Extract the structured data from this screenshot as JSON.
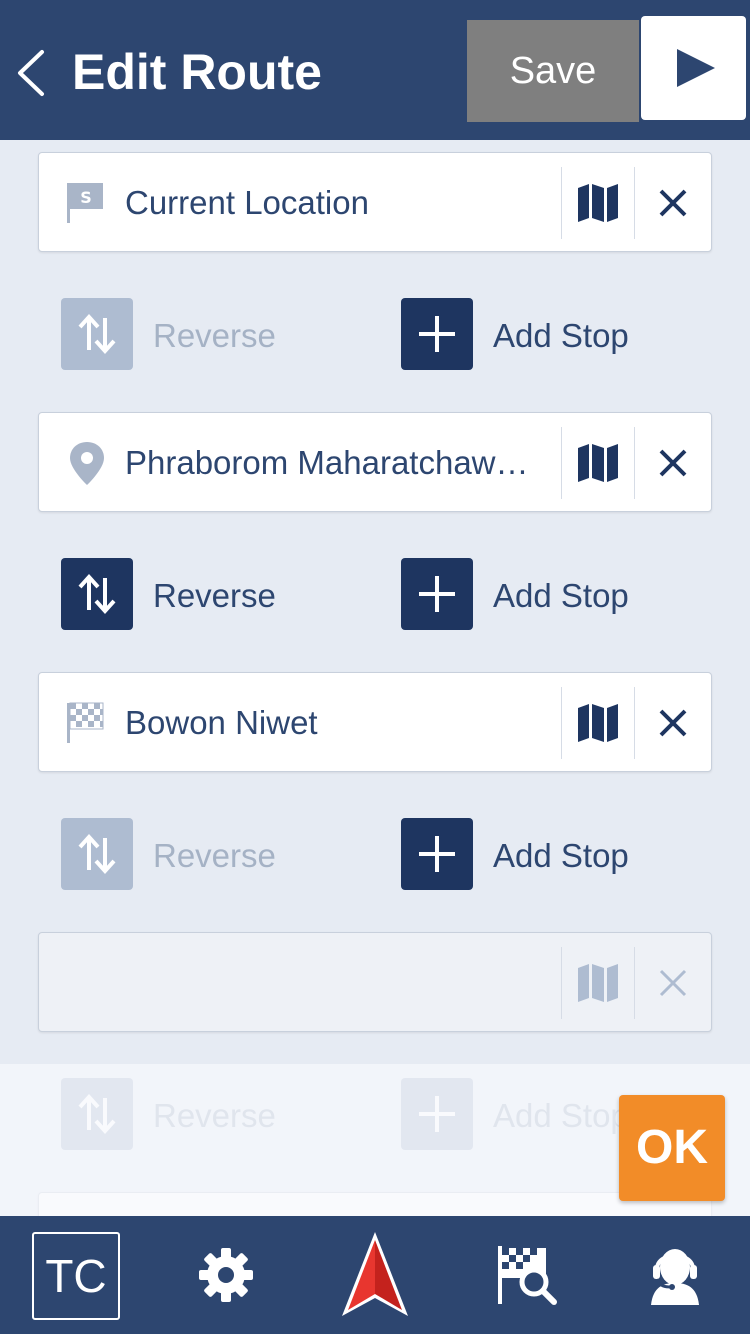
{
  "header": {
    "title": "Edit Route",
    "save_label": "Save"
  },
  "stops": [
    {
      "name": "Current Location",
      "icon": "start-flag-icon",
      "enabled": true
    },
    {
      "name": "Phraborom Maharatchawang",
      "icon": "location-pin-icon",
      "enabled": true
    },
    {
      "name": "Bowon Niwet",
      "icon": "finish-flag-icon",
      "enabled": true
    },
    {
      "name": "",
      "icon": "none",
      "enabled": false
    }
  ],
  "actions": [
    {
      "reverse_label": "Reverse",
      "reverse_enabled": false,
      "add_stop_label": "Add Stop",
      "add_stop_enabled": true
    },
    {
      "reverse_label": "Reverse",
      "reverse_enabled": true,
      "add_stop_label": "Add Stop",
      "add_stop_enabled": true
    },
    {
      "reverse_label": "Reverse",
      "reverse_enabled": false,
      "add_stop_label": "Add Stop",
      "add_stop_enabled": true
    },
    {
      "reverse_label": "Reverse",
      "reverse_enabled": false,
      "add_stop_label": "Add Stop",
      "add_stop_enabled": false
    }
  ],
  "ok_label": "OK",
  "tabbar": {
    "tc_label": "TC",
    "items": [
      "tc-icon",
      "gear-icon",
      "navigation-arrow-icon",
      "route-search-icon",
      "support-agent-icon"
    ]
  },
  "colors": {
    "header_bg": "#2d4670",
    "primary": "#1e3560",
    "text": "#2d4670",
    "disabled": "#aebcd1",
    "save_bg": "#7f7f7f",
    "ok_bg": "#f28c28",
    "nav_arrow": "#e0312b"
  }
}
